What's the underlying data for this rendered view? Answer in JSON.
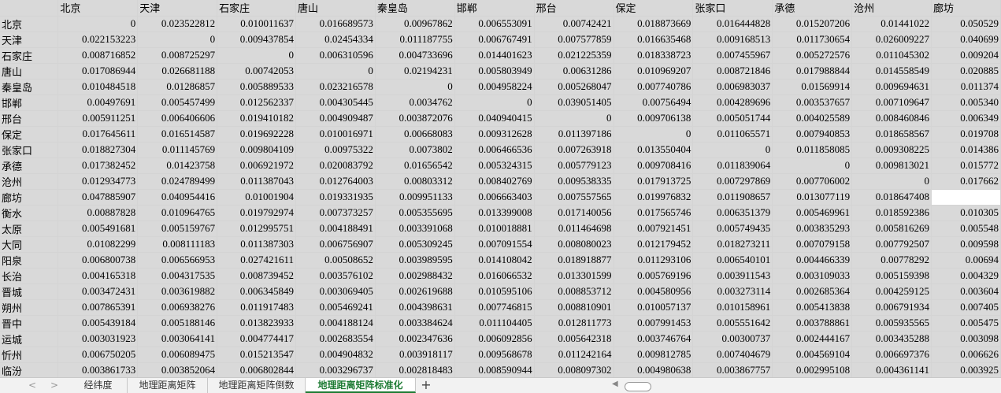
{
  "columns": [
    "北京",
    "天津",
    "石家庄",
    "唐山",
    "秦皇岛",
    "邯郸",
    "邢台",
    "保定",
    "张家口",
    "承德",
    "沧州",
    "廊坊"
  ],
  "rows": [
    {
      "name": "北京",
      "values": [
        "0",
        "0.023522812",
        "0.010011637",
        "0.016689573",
        "0.00967862",
        "0.006553091",
        "0.00742421",
        "0.018873669",
        "0.016444828",
        "0.015207206",
        "0.01441022",
        "0.050529"
      ]
    },
    {
      "name": "天津",
      "values": [
        "0.022153223",
        "0",
        "0.009437854",
        "0.02454334",
        "0.011187755",
        "0.006767491",
        "0.007577859",
        "0.016635468",
        "0.009168513",
        "0.011730654",
        "0.026009227",
        "0.040699"
      ]
    },
    {
      "name": "石家庄",
      "values": [
        "0.008716852",
        "0.008725297",
        "0",
        "0.006310596",
        "0.004733696",
        "0.014401623",
        "0.021225359",
        "0.018338723",
        "0.007455967",
        "0.005272576",
        "0.011045302",
        "0.009204"
      ]
    },
    {
      "name": "唐山",
      "values": [
        "0.017086944",
        "0.026681188",
        "0.00742053",
        "0",
        "0.02194231",
        "0.005803949",
        "0.00631286",
        "0.010969207",
        "0.008721846",
        "0.017988844",
        "0.014558549",
        "0.020885"
      ]
    },
    {
      "name": "秦皇岛",
      "values": [
        "0.010484518",
        "0.01286857",
        "0.005889533",
        "0.023216578",
        "0",
        "0.004958224",
        "0.005268047",
        "0.007740786",
        "0.006983037",
        "0.01569914",
        "0.009694631",
        "0.011374"
      ]
    },
    {
      "name": "邯郸",
      "values": [
        "0.00497691",
        "0.005457499",
        "0.012562337",
        "0.004305445",
        "0.0034762",
        "0",
        "0.039051405",
        "0.00756494",
        "0.004289696",
        "0.003537657",
        "0.007109647",
        "0.005340"
      ]
    },
    {
      "name": "邢台",
      "values": [
        "0.005911251",
        "0.006406606",
        "0.019410182",
        "0.004909487",
        "0.003872076",
        "0.040940415",
        "0",
        "0.009706138",
        "0.005051744",
        "0.004025589",
        "0.008460846",
        "0.006349"
      ]
    },
    {
      "name": "保定",
      "values": [
        "0.017645611",
        "0.016514587",
        "0.019692228",
        "0.010016971",
        "0.00668083",
        "0.009312628",
        "0.011397186",
        "0",
        "0.011065571",
        "0.007940853",
        "0.018658567",
        "0.019708"
      ]
    },
    {
      "name": "张家口",
      "values": [
        "0.018827304",
        "0.011145769",
        "0.009804109",
        "0.00975322",
        "0.0073802",
        "0.006466536",
        "0.007263918",
        "0.013550404",
        "0",
        "0.011858085",
        "0.009308225",
        "0.014386"
      ]
    },
    {
      "name": "承德",
      "values": [
        "0.017382452",
        "0.01423758",
        "0.006921972",
        "0.020083792",
        "0.01656542",
        "0.005324315",
        "0.005779123",
        "0.009708416",
        "0.011839064",
        "0",
        "0.009813021",
        "0.015772"
      ]
    },
    {
      "name": "沧州",
      "values": [
        "0.012934773",
        "0.024789499",
        "0.011387043",
        "0.012764003",
        "0.00803312",
        "0.008402769",
        "0.009538335",
        "0.017913725",
        "0.007297869",
        "0.007706002",
        "0",
        "0.017662"
      ]
    },
    {
      "name": "廊坊",
      "values": [
        "0.047885907",
        "0.040954416",
        "0.01001904",
        "0.019331935",
        "0.009951133",
        "0.006663403",
        "0.007557565",
        "0.019976832",
        "0.011908657",
        "0.013077119",
        "0.018647408",
        ""
      ]
    },
    {
      "name": "衡水",
      "values": [
        "0.00887828",
        "0.010964765",
        "0.019792974",
        "0.007373257",
        "0.005355695",
        "0.013399008",
        "0.017140056",
        "0.017565746",
        "0.006351379",
        "0.005469961",
        "0.018592386",
        "0.010305"
      ]
    },
    {
      "name": "太原",
      "values": [
        "0.005491681",
        "0.005159767",
        "0.012995751",
        "0.004188491",
        "0.003391068",
        "0.010018881",
        "0.011464698",
        "0.007921451",
        "0.005749435",
        "0.003835293",
        "0.005816269",
        "0.005548"
      ]
    },
    {
      "name": "大同",
      "values": [
        "0.01082299",
        "0.008111183",
        "0.011387303",
        "0.006756907",
        "0.005309245",
        "0.007091554",
        "0.008080023",
        "0.012179452",
        "0.018273211",
        "0.007079158",
        "0.007792507",
        "0.009598"
      ]
    },
    {
      "name": "阳泉",
      "values": [
        "0.006800738",
        "0.006566953",
        "0.027421611",
        "0.00508652",
        "0.003989595",
        "0.014108042",
        "0.018918877",
        "0.011293106",
        "0.006540101",
        "0.004466339",
        "0.00778292",
        "0.00694"
      ]
    },
    {
      "name": "长治",
      "values": [
        "0.004165318",
        "0.004317535",
        "0.008739452",
        "0.003576102",
        "0.002988432",
        "0.016066532",
        "0.013301599",
        "0.005769196",
        "0.003911543",
        "0.003109033",
        "0.005159398",
        "0.004329"
      ]
    },
    {
      "name": "晋城",
      "values": [
        "0.003472431",
        "0.003619882",
        "0.006345849",
        "0.003069405",
        "0.002619688",
        "0.010595106",
        "0.008853712",
        "0.004580956",
        "0.003273114",
        "0.002685364",
        "0.004259125",
        "0.003604"
      ]
    },
    {
      "name": "朔州",
      "values": [
        "0.007865391",
        "0.006938276",
        "0.011917483",
        "0.005469241",
        "0.004398631",
        "0.007746815",
        "0.008810901",
        "0.010057137",
        "0.010158961",
        "0.005413838",
        "0.006791934",
        "0.007405"
      ]
    },
    {
      "name": "晋中",
      "values": [
        "0.005439184",
        "0.005188146",
        "0.013823933",
        "0.004188124",
        "0.003384624",
        "0.011104405",
        "0.012811773",
        "0.007991453",
        "0.005551642",
        "0.003788861",
        "0.005935565",
        "0.005475"
      ]
    },
    {
      "name": "运城",
      "values": [
        "0.003031923",
        "0.003064141",
        "0.004774417",
        "0.002683554",
        "0.002347636",
        "0.006092856",
        "0.005642318",
        "0.003746764",
        "0.00300737",
        "0.002444167",
        "0.003435288",
        "0.003098"
      ]
    },
    {
      "name": "忻州",
      "values": [
        "0.006750205",
        "0.006089475",
        "0.015213547",
        "0.004904832",
        "0.003918117",
        "0.009568678",
        "0.011242164",
        "0.009812785",
        "0.007404679",
        "0.004569104",
        "0.006697376",
        "0.006626"
      ]
    },
    {
      "name": "临汾",
      "values": [
        "0.003861733",
        "0.003852064",
        "0.006802844",
        "0.003296737",
        "0.002818483",
        "0.008590944",
        "0.008097302",
        "0.004980638",
        "0.003867757",
        "0.002995108",
        "0.004361141",
        "0.003925"
      ]
    }
  ],
  "sheet_tabs": {
    "tab1": "经纬度",
    "tab2": "地理距离矩阵",
    "tab3": "地理距离矩阵倒数",
    "tab4": "地理距离矩阵标准化",
    "add": "+"
  },
  "tab_nav": {
    "prev": "<",
    "next": ">"
  },
  "colors": {
    "active_tab": "#1e7b34",
    "cell_fill": "#d9d9d9",
    "grid": "#d4d4d4"
  }
}
